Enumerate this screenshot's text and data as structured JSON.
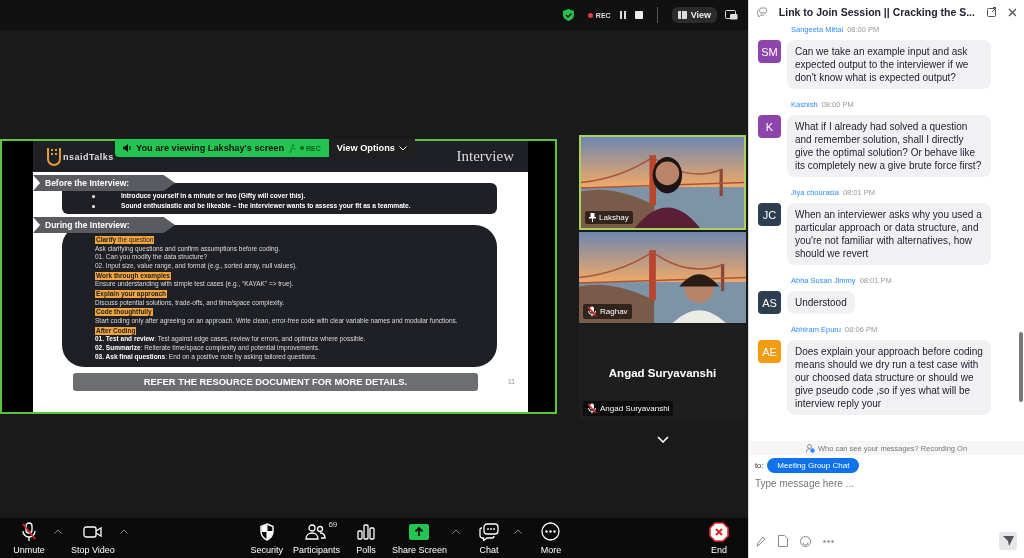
{
  "top_bar": {
    "recording_label": "REC",
    "view_label": "View"
  },
  "share_banner": {
    "text": "You are viewing  Lakshay's screen",
    "recording_label": "REC",
    "view_options": "View Options"
  },
  "slide": {
    "logo_text": "nsaidTalks",
    "title": "Interview",
    "sections": [
      {
        "heading": "Before the Interview:",
        "items": [
          {
            "kind": "bullet",
            "text": "Introduce yourself in a minute or two (Gifty will cover this)."
          },
          {
            "kind": "bullet",
            "text": "Sound enthusiastic and be likeable – the interviewer wants to assess your fit as a teammate."
          }
        ]
      },
      {
        "heading": "During  the Interview:",
        "items": [
          {
            "kind": "heading",
            "text": "**Clarify** the question"
          },
          {
            "kind": "text",
            "text": "Ask clarifying questions and confirm assumptions before coding."
          },
          {
            "kind": "text",
            "text": "01.  Can you modify the data structure?"
          },
          {
            "kind": "text",
            "text": "02.   Input size, value range, and format (e.g., sorted array, null values)."
          },
          {
            "kind": "heading",
            "text": "**Work through examples**"
          },
          {
            "kind": "text",
            "text": "Ensure understanding with simple test cases (e.g., “KAYAK” => true)."
          },
          {
            "kind": "heading",
            "text": "**Explain your approach**"
          },
          {
            "kind": "text",
            "text": "Discuss potential solutions, trade-offs, and time/space complexity."
          },
          {
            "kind": "heading",
            "text": "**Code thoughtfully**"
          },
          {
            "kind": "text",
            "text": "Start coding only after agreeing on an approach. Write clean, error-free code with clear variable names and modular functions."
          },
          {
            "kind": "heading",
            "text": "**After Coding**"
          },
          {
            "kind": "text",
            "text": "**01. Test and review**: Test against edge cases, review for errors, and optimize where possible."
          },
          {
            "kind": "text",
            "text": "**02. Summarize**: Reiterate time/space complexity and potential improvements."
          },
          {
            "kind": "text",
            "text": "**03. Ask final questions**: End on a positive note by asking tailored questions."
          }
        ]
      }
    ],
    "footer": "REFER THE RESOURCE DOCUMENT FOR MORE DETAILS.",
    "page_number": "11"
  },
  "videos": [
    {
      "name": "Lakshay",
      "kind": "camera",
      "active": true,
      "pinned": true,
      "muted": false
    },
    {
      "name": "Raghav",
      "kind": "camera",
      "active": false,
      "pinned": false,
      "muted": true
    },
    {
      "name": "Angad Suryavanshi",
      "display_name": "Angad Suryavanshi",
      "kind": "name_only",
      "active": false,
      "pinned": false,
      "muted": true
    }
  ],
  "toolbar": [
    {
      "kind": "mic_off",
      "label": "Unmute",
      "caret": true
    },
    {
      "kind": "video",
      "label": "Stop Video",
      "caret": true
    },
    {
      "kind": "security",
      "label": "Security",
      "caret": false
    },
    {
      "kind": "participants",
      "label": "Participants",
      "badge": "69",
      "caret": false
    },
    {
      "kind": "polls",
      "label": "Polls",
      "caret": false
    },
    {
      "kind": "share",
      "label": "Share Screen",
      "caret": true
    },
    {
      "kind": "chat",
      "label": "Chat",
      "caret": true
    },
    {
      "kind": "more",
      "label": "More",
      "caret": false
    },
    {
      "kind": "end",
      "label": "End",
      "caret": false
    }
  ],
  "chat": {
    "title": "Link to Join Session || Cracking the S...",
    "messages": [
      {
        "sender": "Sangeeta Mittal",
        "time": "08:00 PM",
        "initials": "SM",
        "color": "#8e44ad",
        "text": "Can we take an example input and ask expected output to the interviewer if we don't know what is expected output?"
      },
      {
        "sender": "Kashish",
        "time": "08:00 PM",
        "initials": "K",
        "color": "#8e44ad",
        "text": "What if I already had solved a question and remember solution, shall I directly give the optimal solution? Or behave like its completely new a give brute force first?"
      },
      {
        "sender": "Jiya chourasia",
        "time": "08:01 PM",
        "initials": "JC",
        "color": "#2c3e50",
        "text": "When an interviewer asks why you used a particular approach or data structure, and you're not familiar with alternatives, how should we revert"
      },
      {
        "sender": "Abha Susan Jimmy",
        "time": "08:01 PM",
        "initials": "AS",
        "color": "#2c3e50",
        "text": "Understood"
      },
      {
        "sender": "Abhiram Epuru",
        "time": "08:06 PM",
        "initials": "AE",
        "color": "#f39c12",
        "text": "Does explain your approach before coding means should we dry run  a test case with our choosed data structure or should we give pseudo code ,so if yes what will be interview reply your"
      }
    ],
    "notice": "Who can see your messages? Recording On",
    "to_label": "to:",
    "recipient": "Meeting Group Chat",
    "placeholder": "Type message here ..."
  }
}
